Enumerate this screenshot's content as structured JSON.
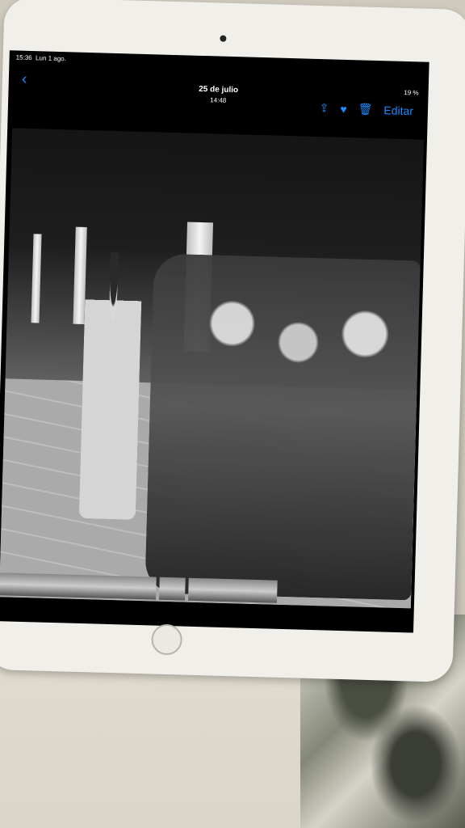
{
  "status_bar": {
    "time": "15:36",
    "date": "Lun 1 ago.",
    "battery": "19 %"
  },
  "nav": {
    "back_icon": "chevron-left-icon",
    "title": "25 de julio",
    "subtitle": "14:48",
    "share_icon": "share-icon",
    "favorite_icon": "heart-icon",
    "delete_icon": "trash-icon",
    "edit_label": "Editar"
  },
  "colors": {
    "accent": "#1a8cff"
  }
}
